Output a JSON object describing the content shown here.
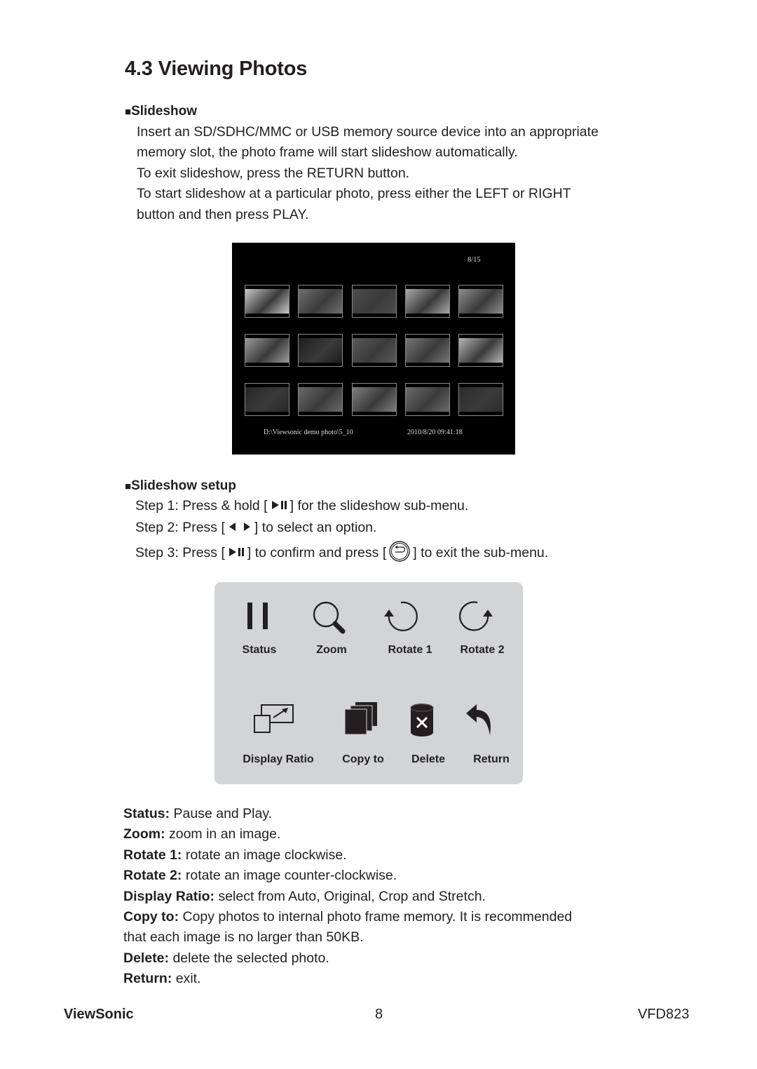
{
  "heading": "4.3 Viewing Photos",
  "slideshow": {
    "bullet": "■",
    "title": "Slideshow",
    "lines": [
      "Insert an SD/SDHC/MMC or USB memory source device into an appropriate",
      "memory slot, the photo frame will start slideshow automatically.",
      "To exit slideshow, press the RETURN button.",
      "To start slideshow at a particular photo, press either the LEFT or RIGHT",
      "button and then press PLAY."
    ]
  },
  "screen": {
    "counter": "8/15",
    "path": "D:\\Viewsonic demo photo\\5_10",
    "datetime": "2010/8/20 09:41:18",
    "thumbnails": [
      {
        "name": "thumb-woman-portrait",
        "tone": "#c9c9c9"
      },
      {
        "name": "thumb-beach-children",
        "tone": "#6f6f6f"
      },
      {
        "name": "thumb-penguin",
        "tone": "#4d4d4d"
      },
      {
        "name": "thumb-child-water",
        "tone": "#a8a8a8"
      },
      {
        "name": "thumb-family-smiling",
        "tone": "#8d8d8d"
      },
      {
        "name": "thumb-tiger",
        "tone": "#9a9a9a"
      },
      {
        "name": "thumb-monitor-product",
        "tone": "#1e1e1e"
      },
      {
        "name": "thumb-family-picnic",
        "tone": "#5a5a5a"
      },
      {
        "name": "thumb-couple-outdoors",
        "tone": "#767676"
      },
      {
        "name": "thumb-beach-waves",
        "tone": "#b4b4b4"
      },
      {
        "name": "thumb-projector-product",
        "tone": "#262626"
      },
      {
        "name": "thumb-boy-smiling",
        "tone": "#6a6a6a"
      },
      {
        "name": "thumb-older-couple",
        "tone": "#7e7e7e"
      },
      {
        "name": "thumb-group-photo",
        "tone": "#6c6c6c"
      },
      {
        "name": "thumb-photo-frame-product",
        "tone": "#2c2c2c"
      }
    ]
  },
  "setup": {
    "bullet": "■",
    "title": "Slideshow setup",
    "step1": {
      "prefix": "Step 1: Press & hold [",
      "icon": "play-pause",
      "suffix": "] for the slideshow sub-menu."
    },
    "step2": {
      "prefix": "Step 2: Press [",
      "icon": "left-right",
      "suffix": "] to select an option."
    },
    "step3": {
      "prefix": "Step 3: Press [",
      "icon": "play-pause",
      "middle": "] to confirm and press [",
      "icon2": "return-button",
      "suffix": "] to exit the sub-menu."
    }
  },
  "menu": {
    "colors": {
      "background": "#d3d4d6",
      "icon": "#231f20"
    },
    "items": [
      {
        "label": "Status",
        "icon": "pause-icon"
      },
      {
        "label": "Zoom",
        "icon": "magnifier-icon"
      },
      {
        "label": "Rotate 1",
        "icon": "rotate-left-icon"
      },
      {
        "label": "Rotate 2",
        "icon": "rotate-right-icon"
      },
      {
        "label": "Display Ratio",
        "icon": "display-ratio-icon"
      },
      {
        "label": "Copy to",
        "icon": "copy-stack-icon"
      },
      {
        "label": "Delete",
        "icon": "delete-bin-icon"
      },
      {
        "label": "Return",
        "icon": "return-arrow-icon"
      }
    ]
  },
  "descriptions": [
    {
      "term": "Status:",
      "text": " Pause and Play."
    },
    {
      "term": "Zoom:",
      "text": " zoom in an image."
    },
    {
      "term": "Rotate 1:",
      "text": " rotate an image clockwise."
    },
    {
      "term": "Rotate 2:",
      "text": " rotate an image counter-clockwise."
    },
    {
      "term": "Display Ratio:",
      "text": " select from Auto, Original, Crop and Stretch."
    },
    {
      "term": "Copy to:",
      "text": " Copy photos to internal photo frame memory. It is recommended"
    },
    {
      "term": "",
      "text": "that each image is no larger than 50KB."
    },
    {
      "term": "Delete:",
      "text": " delete the selected photo."
    },
    {
      "term": "Return:",
      "text": " exit."
    }
  ],
  "footer": {
    "brand": "ViewSonic",
    "page": "8",
    "model": "VFD823"
  }
}
